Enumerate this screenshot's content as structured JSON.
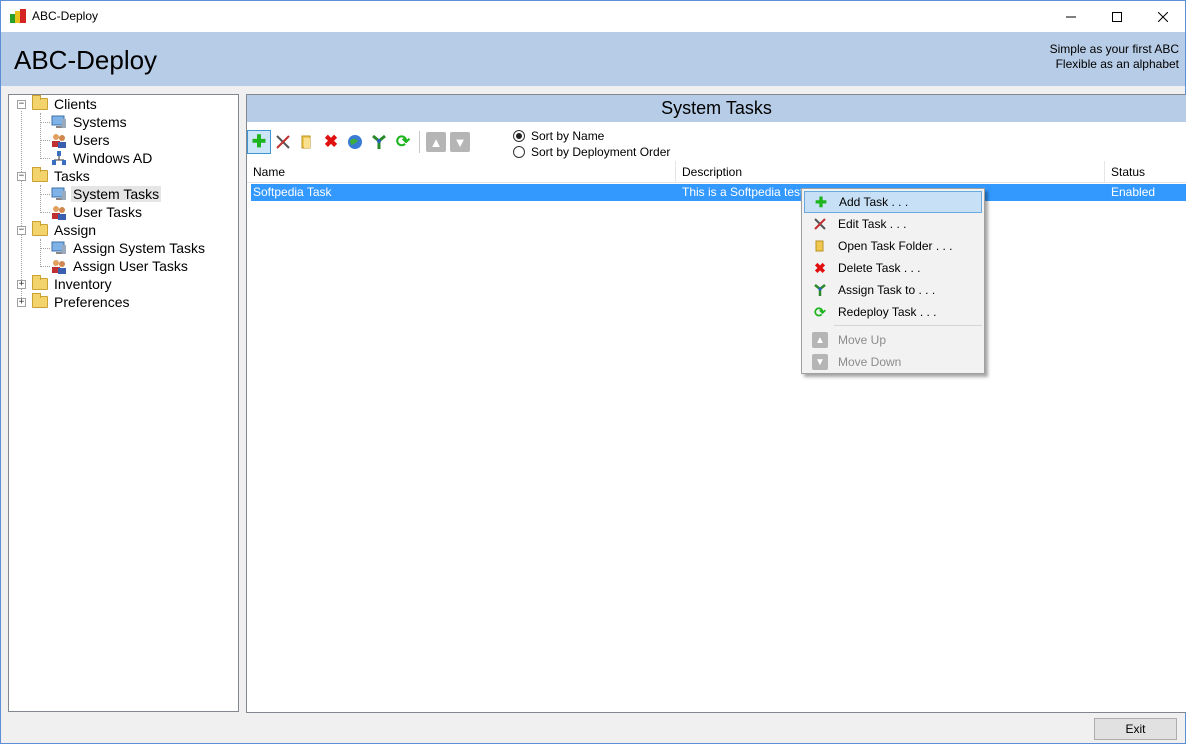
{
  "window": {
    "title": "ABC-Deploy"
  },
  "header": {
    "title": "ABC-Deploy",
    "slogan_line1": "Simple as your first ABC",
    "slogan_line2": "Flexible as an alphabet"
  },
  "tree": {
    "items": [
      {
        "label": "Clients"
      },
      {
        "label": "Systems"
      },
      {
        "label": "Users"
      },
      {
        "label": "Windows AD"
      },
      {
        "label": "Tasks"
      },
      {
        "label": "System Tasks",
        "selected": true
      },
      {
        "label": "User Tasks"
      },
      {
        "label": "Assign"
      },
      {
        "label": "Assign System Tasks"
      },
      {
        "label": "Assign User Tasks"
      },
      {
        "label": "Inventory"
      },
      {
        "label": "Preferences"
      }
    ]
  },
  "main": {
    "panel_title": "System Tasks",
    "sort_options": [
      "Sort by Name",
      "Sort by Deployment Order"
    ],
    "sort_selected": "Sort by Name",
    "columns": [
      "Name",
      "Description",
      "Status"
    ],
    "rows": [
      {
        "name": "Softpedia Task",
        "description": "This is a Softpedia test",
        "status": "Enabled"
      }
    ]
  },
  "context_menu": {
    "items": [
      {
        "label": "Add Task . . .",
        "icon": "plus-icon"
      },
      {
        "label": "Edit Task . . .",
        "icon": "tools-icon"
      },
      {
        "label": "Open Task Folder . . .",
        "icon": "folder-icon"
      },
      {
        "label": "Delete Task . . .",
        "icon": "delete-icon"
      },
      {
        "label": "Assign Task to . . .",
        "icon": "assign-icon"
      },
      {
        "label": "Redeploy Task . . .",
        "icon": "redeploy-icon"
      },
      {
        "label": "Move Up",
        "icon": "arrow-up-icon",
        "disabled": true
      },
      {
        "label": "Move Down",
        "icon": "arrow-down-icon",
        "disabled": true
      }
    ]
  },
  "footer": {
    "exit_label": "Exit"
  },
  "colors": {
    "header_bg": "#b7cce6",
    "selection": "#3399ff"
  }
}
